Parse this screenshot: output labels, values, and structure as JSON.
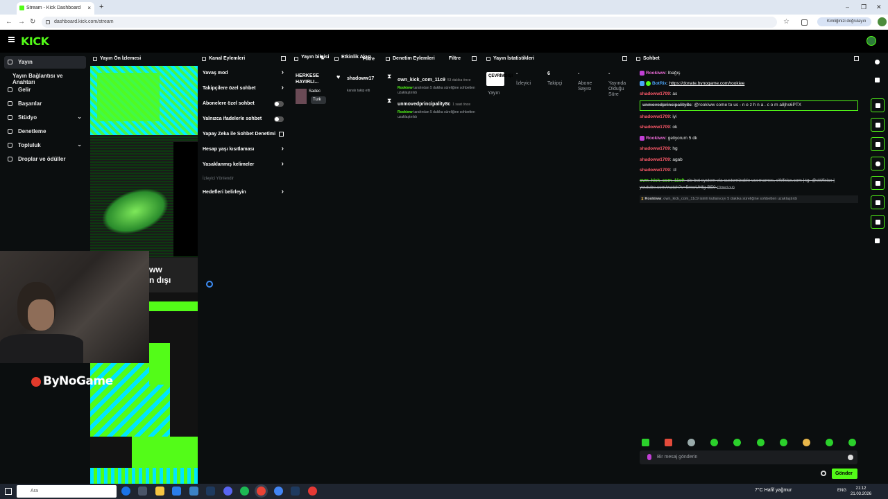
{
  "browser": {
    "tab_title": "Stream - Kick Dashboard",
    "url": "dashboard.kick.com/stream",
    "profile_label": "Kimliğinizi doğrulayın"
  },
  "sidebar": {
    "items": [
      {
        "label": "Yayın"
      },
      {
        "label": "Yayın Bağlantısı ve Anahtarı"
      },
      {
        "label": "Gelir"
      },
      {
        "label": "Başarılar"
      },
      {
        "label": "Stüdyo"
      },
      {
        "label": "Denetleme"
      },
      {
        "label": "Topluluk"
      },
      {
        "label": "Droplar ve ödüller"
      }
    ]
  },
  "panels": {
    "preview": "Yayın Ön İzlemesi",
    "channel_actions": "Kanal Eylemleri",
    "stream_info": "Yayın bilgisi",
    "activity": "Etkinlik Akışı",
    "activity_filter": "Filtre",
    "mod_actions": "Denetim Eylemleri",
    "mod_filter": "Filtre",
    "stats": "Yayın İstatistikleri",
    "chat": "Sohbet"
  },
  "preview": {
    "overlay_line1": "ww",
    "overlay_line2": "n dışı",
    "sponsor": "ByNoGame"
  },
  "channel_actions": {
    "items": [
      {
        "label": "Yavaş mod",
        "control": "chevron"
      },
      {
        "label": "Takipçilere özel sohbet",
        "control": "chevron"
      },
      {
        "label": "Abonelere özel sohbet",
        "control": "toggle"
      },
      {
        "label": "Yalnızca ifadelerle sohbet",
        "control": "toggle"
      },
      {
        "label": "Yapay Zeka ile Sohbet Denetimi",
        "control": "external"
      },
      {
        "label": "Hesap yaşı kısıtlaması",
        "control": "chevron"
      },
      {
        "label": "Yasaklanmış kelimeler",
        "control": "chevron"
      }
    ],
    "section": "İzleyici Yönlendir",
    "goals": "Hedefleri belirleyin"
  },
  "stream_info": {
    "title": "HERKESE HAYIRLI...",
    "tag": "Sadec",
    "language": "Turk"
  },
  "activity": {
    "user": "shadoww17",
    "desc": "kanalı takip etti"
  },
  "mod_actions": [
    {
      "user": "own_kick_com_11c9",
      "time": "53 dakika önce",
      "by": "Rookiww",
      "desc": "tarafından 5 dakika süreliğine sohbetten uzaklaştırıldı"
    },
    {
      "user": "unmovedprincipality8c",
      "time": "1 saat önce",
      "by": "Rookiww",
      "desc": "tarafından 5 dakika süreliğine sohbetten uzaklaştırıldı"
    }
  ],
  "stats": {
    "status": "ÇEVRİMDIŞI",
    "status_label": "Yayın",
    "viewers_value": "-",
    "viewers_label": "İzleyici",
    "followers_value": "6",
    "followers_label": "Takipçi",
    "subs_value": "-",
    "subs_label": "Abone Sayısı",
    "uptime_value": "-",
    "uptime_label": "Yayında Olduğu Süre"
  },
  "chat": {
    "messages": [
      {
        "user": "Rookiww",
        "text": ": İbağış",
        "color": "#e96bd5"
      },
      {
        "user": "BotRix",
        "text": ": ",
        "link": "https://donate.bynogame.com/rookiee",
        "color": "#4ba3f5"
      },
      {
        "user": "shadoww1709",
        "text": ": as",
        "color": "#ff5a6a"
      },
      {
        "user": "unmovedprincipality8c",
        "text": ": @rookiww come to us - n e z h n a . c o m a8jhs6PTX",
        "color": "#b5b9bd"
      },
      {
        "user": "shadoww1709",
        "text": ": iyi",
        "color": "#ff5a6a"
      },
      {
        "user": "shadoww1709",
        "text": ": ok",
        "color": "#ff5a6a"
      },
      {
        "user": "Rookiww",
        "text": ": geliyorum 5 dk",
        "color": "#e96bd5"
      },
      {
        "user": "shadoww1709",
        "text": ": hg",
        "color": "#ff5a6a"
      },
      {
        "user": "shadoww1709",
        "text": ": agab",
        "color": "#ff5a6a"
      },
      {
        "user": "shadoww1709",
        "text": ": :d",
        "color": "#ff5a6a"
      },
      {
        "user": "own_kick_com_11c9",
        "text": ": aio bot system via customizable usernames, oWfxicx.com | tg: @oWfxicx | youtube.com/watch?v=5mwUHfg-BE0",
        "note": "(Timed out)",
        "color": "#53fc18"
      },
      {
        "user": "Rookiww",
        "text": ", own_kick_com_11c9 isimli kullanıcıyı 5 dakika süreliğine sohbetten uzaklaştırdı",
        "color": "#e8e8e8"
      }
    ],
    "placeholder": "Bir mesaj gönderin",
    "send": "Gönder"
  },
  "taskbar": {
    "search": "Ara",
    "weather": "7°C  Hafif yağmur",
    "lang": "ENG",
    "time": "21:12",
    "date": "21.03.2026"
  },
  "colors": {
    "accent": "#53fc18",
    "panel_bg": "#0b0e0f"
  }
}
